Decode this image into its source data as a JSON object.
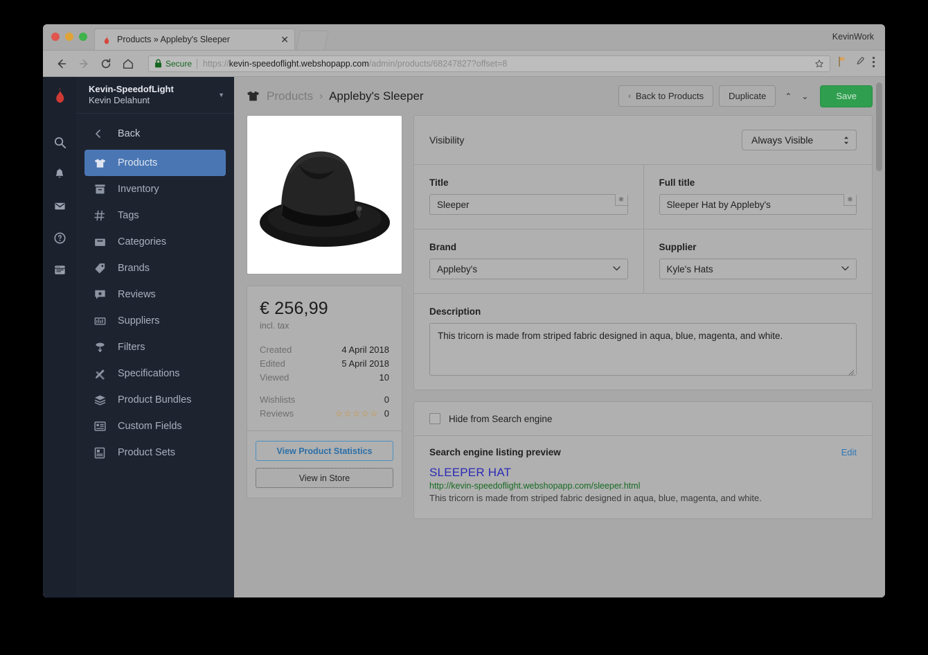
{
  "browser": {
    "tab": {
      "title": "Products » Appleby's Sleeper",
      "close": "✕"
    },
    "window_label": "KevinWork",
    "omnibox": {
      "secure_label": "Secure",
      "url_scheme": "https://",
      "url_host": "kevin-speedoflight.webshopapp.com",
      "url_path": "/admin/products/68247827?offset=8"
    }
  },
  "rail": {
    "icons": [
      "flame-logo-icon",
      "search-icon",
      "bell-icon",
      "envelope-icon",
      "help-circle-icon",
      "browser-window-icon"
    ]
  },
  "sidebar": {
    "shop": "Kevin-SpeedofLight",
    "user": "Kevin Delahunt",
    "back_label": "Back",
    "items": [
      {
        "label": "Products",
        "icon": "tshirt-icon",
        "active": true
      },
      {
        "label": "Inventory",
        "icon": "archive-icon",
        "active": false
      },
      {
        "label": "Tags",
        "icon": "hash-icon",
        "active": false
      },
      {
        "label": "Categories",
        "icon": "folder-icon",
        "active": false
      },
      {
        "label": "Brands",
        "icon": "tag-icon",
        "active": false
      },
      {
        "label": "Reviews",
        "icon": "comment-star-icon",
        "active": false
      },
      {
        "label": "Suppliers",
        "icon": "truck-icon",
        "active": false
      },
      {
        "label": "Filters",
        "icon": "filter-icon",
        "active": false
      },
      {
        "label": "Specifications",
        "icon": "pencil-ruler-icon",
        "active": false
      },
      {
        "label": "Product Bundles",
        "icon": "layers-icon",
        "active": false
      },
      {
        "label": "Custom Fields",
        "icon": "list-box-icon",
        "active": false
      },
      {
        "label": "Product Sets",
        "icon": "note-icon",
        "active": false
      }
    ]
  },
  "topbar": {
    "breadcrumb_root": "Products",
    "breadcrumb_sep": "›",
    "breadcrumb_current": "Appleby's Sleeper",
    "back_to_products": "Back to Products",
    "back_chevron": "‹",
    "duplicate": "Duplicate",
    "prev_arrow": "⌃",
    "next_arrow": "⌄",
    "save": "Save",
    "save_color": "#2f9e4e"
  },
  "product": {
    "image_alt": "black-fedora-hat",
    "price": "€ 256,99",
    "price_note": "incl. tax",
    "stats": [
      {
        "key": "Created",
        "value": "4 April 2018"
      },
      {
        "key": "Edited",
        "value": "5 April 2018"
      },
      {
        "key": "Viewed",
        "value": "10"
      }
    ],
    "wishlists_key": "Wishlists",
    "wishlists_value": "0",
    "reviews_key": "Reviews",
    "reviews_stars": "☆☆☆☆☆",
    "reviews_value": "0",
    "star_color": "#d2912b",
    "view_statistics": "View Product Statistics",
    "view_in_store": "View in Store"
  },
  "form": {
    "visibility_label": "Visibility",
    "visibility_value": "Always Visible",
    "title_label": "Title",
    "title_value": "Sleeper",
    "fulltitle_label": "Full title",
    "fulltitle_value": "Sleeper Hat by Appleby's",
    "required_marker": "✱",
    "brand_label": "Brand",
    "brand_value": "Appleby's",
    "supplier_label": "Supplier",
    "supplier_value": "Kyle's Hats",
    "description_label": "Description",
    "description_value": "This tricorn is made from striped fabric designed in aqua, blue, magenta, and white.",
    "chevron": "⌄"
  },
  "seo": {
    "hide_label": "Hide from Search engine",
    "preview_heading": "Search engine listing preview",
    "edit_label": "Edit",
    "listing_title": "SLEEPER HAT",
    "listing_url": "http://kevin-speedoflight.webshopapp.com/sleeper.html",
    "listing_desc": "This tricorn is made from striped fabric designed in aqua, blue, magenta, and white.",
    "title_color": "#2a2ab5",
    "url_color": "#166b22",
    "link_color": "#2e77b8"
  }
}
